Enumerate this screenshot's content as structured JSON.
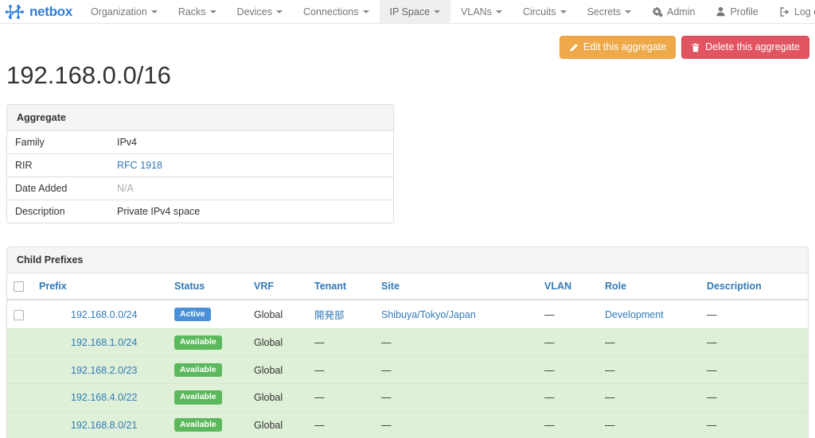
{
  "navbar": {
    "brand": "netbox",
    "menu": [
      {
        "label": "Organization",
        "has_caret": true,
        "active": false
      },
      {
        "label": "Racks",
        "has_caret": true,
        "active": false
      },
      {
        "label": "Devices",
        "has_caret": true,
        "active": false
      },
      {
        "label": "Connections",
        "has_caret": true,
        "active": false
      },
      {
        "label": "IP Space",
        "has_caret": true,
        "active": true
      },
      {
        "label": "VLANs",
        "has_caret": true,
        "active": false
      },
      {
        "label": "Circuits",
        "has_caret": true,
        "active": false
      },
      {
        "label": "Secrets",
        "has_caret": true,
        "active": false
      }
    ],
    "right": [
      {
        "label": "Admin",
        "icon": "gears-icon"
      },
      {
        "label": "Profile",
        "icon": "user-icon"
      },
      {
        "label": "Log out",
        "icon": "sign-out-icon"
      }
    ]
  },
  "actions": {
    "edit_label": "Edit this aggregate",
    "edit_icon": "pencil-icon",
    "edit_color": "#eda94a",
    "delete_label": "Delete this aggregate",
    "delete_icon": "trash-icon",
    "delete_color": "#e05561"
  },
  "page": {
    "title": "192.168.0.0/16"
  },
  "aggregate_panel": {
    "heading": "Aggregate",
    "rows": [
      {
        "label": "Family",
        "value": "IPv4",
        "kind": "text"
      },
      {
        "label": "RIR",
        "value": "RFC 1918",
        "kind": "link"
      },
      {
        "label": "Date Added",
        "value": "N/A",
        "kind": "muted"
      },
      {
        "label": "Description",
        "value": "Private IPv4 space",
        "kind": "text"
      }
    ]
  },
  "child_prefixes": {
    "heading": "Child Prefixes",
    "columns": [
      "Prefix",
      "Status",
      "VRF",
      "Tenant",
      "Site",
      "VLAN",
      "Role",
      "Description"
    ],
    "rows": [
      {
        "checkbox": true,
        "prefix": "192.168.0.0/24",
        "status": "Active",
        "status_color": "#4a90d9",
        "vrf": "Global",
        "tenant": "開発部",
        "site": "Shibuya/Tokyo/Japan",
        "vlan": "—",
        "role": "Development",
        "description": "—",
        "available": false
      },
      {
        "checkbox": false,
        "prefix": "192.168.1.0/24",
        "status": "Available",
        "status_color": "#5cb85c",
        "vrf": "Global",
        "tenant": "—",
        "site": "—",
        "vlan": "—",
        "role": "—",
        "description": "—",
        "available": true
      },
      {
        "checkbox": false,
        "prefix": "192.168.2.0/23",
        "status": "Available",
        "status_color": "#5cb85c",
        "vrf": "Global",
        "tenant": "—",
        "site": "—",
        "vlan": "—",
        "role": "—",
        "description": "—",
        "available": true
      },
      {
        "checkbox": false,
        "prefix": "192.168.4.0/22",
        "status": "Available",
        "status_color": "#5cb85c",
        "vrf": "Global",
        "tenant": "—",
        "site": "—",
        "vlan": "—",
        "role": "—",
        "description": "—",
        "available": true
      },
      {
        "checkbox": false,
        "prefix": "192.168.8.0/21",
        "status": "Available",
        "status_color": "#5cb85c",
        "vrf": "Global",
        "tenant": "—",
        "site": "—",
        "vlan": "—",
        "role": "—",
        "description": "—",
        "available": true
      }
    ]
  }
}
